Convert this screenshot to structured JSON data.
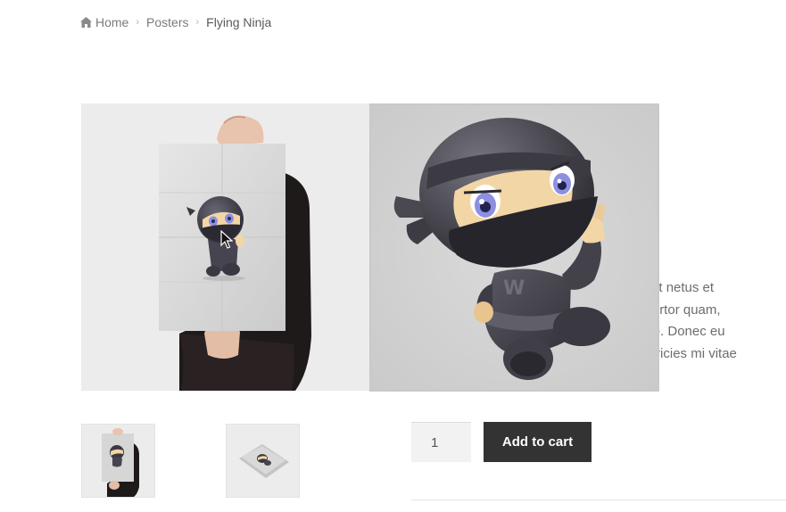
{
  "breadcrumb": {
    "home": "Home",
    "category": "Posters",
    "current": "Flying Ninja"
  },
  "description": {
    "lines": [
      "ectus et netus et",
      "ulum tortor quam,",
      "et, ante. Donec eu",
      "ean ultricies mi vitae"
    ]
  },
  "cart": {
    "quantity": "1",
    "add_to_cart_label": "Add to cart"
  },
  "gallery": {
    "thumbnails": [
      "poster-held-thumbnail",
      "poster-flat-thumbnail"
    ]
  },
  "icons": {
    "home": "home-icon",
    "separator": "chevron-right-icon",
    "cursor": "mouse-pointer-icon"
  },
  "colors": {
    "button_bg": "#333333",
    "button_text": "#ffffff",
    "ninja_body": "#45444f",
    "ninja_skin": "#f3d6a6",
    "ninja_eyes": "#8d8fe0"
  }
}
